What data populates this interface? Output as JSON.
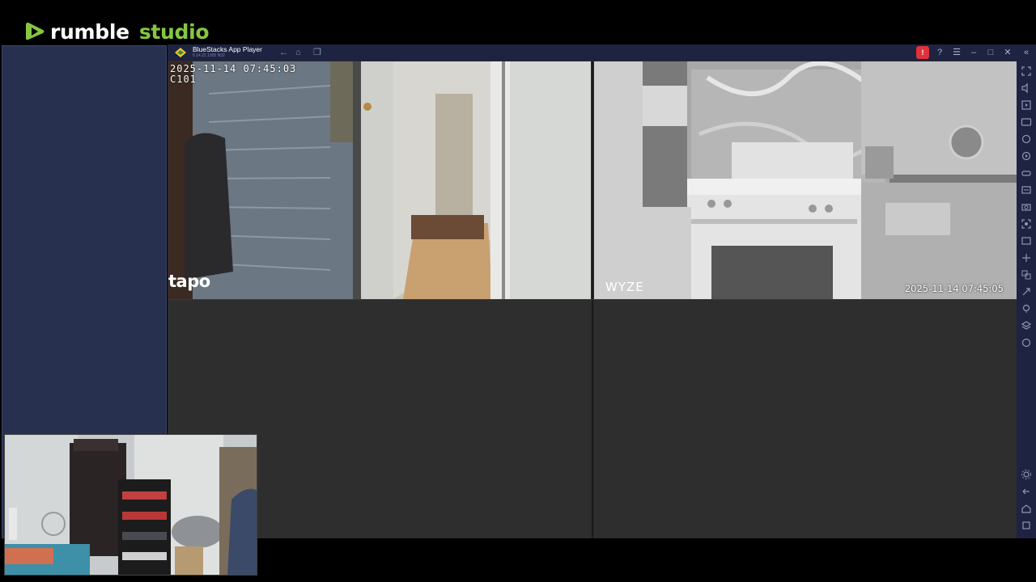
{
  "brand": {
    "rumble": "rumble",
    "studio": "studio"
  },
  "bluestacks": {
    "title": "BlueStacks App Player",
    "version": "5.14.22.1005 N32",
    "notification_badge": "!",
    "icons": {
      "back": "back-arrow-icon",
      "home": "home-icon",
      "recent": "recent-apps-icon",
      "help": "help-icon",
      "menu": "menu-icon",
      "minimize": "minimize-icon",
      "maximize": "maximize-icon",
      "close": "close-icon",
      "collapse": "collapse-sidebar-icon"
    }
  },
  "cameras": {
    "top_left": {
      "timestamp": "2025-11-14 07:45:03",
      "camera_id": "C101",
      "brand": "tapo"
    },
    "top_right": {
      "timestamp": "2025-11-14 07:45:05",
      "brand": "WYZE"
    }
  },
  "colors": {
    "accent": "#85c742",
    "titlebar": "#1d2341",
    "panel": "#27314f",
    "alert": "#e0323a"
  }
}
